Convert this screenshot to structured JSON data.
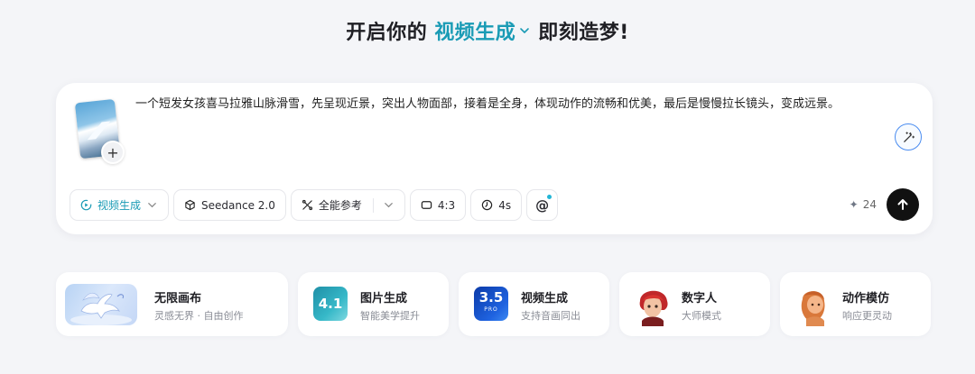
{
  "heading": {
    "prefix": "开启你的",
    "mode": "视频生成",
    "suffix": "即刻造梦!"
  },
  "composer": {
    "prompt": "一个短发女孩喜马拉雅山脉滑雪，先呈现近景，突出人物面部，接着是全身，体现动作的流畅和优美，最后是慢慢拉长镜头，变成远景。",
    "add_label": "+",
    "toolbar": {
      "mode": "视频生成",
      "model": "Seedance 2.0",
      "reference": "全能参考",
      "ratio": "4:3",
      "duration": "4s",
      "mention": "@"
    },
    "credits": "24",
    "colors": {
      "accent": "#1a9bb5",
      "send": "#111111"
    }
  },
  "cards": [
    {
      "title": "无限画布",
      "subtitle": "灵感无界 · 自由创作",
      "icon": "pegasus-canvas-icon"
    },
    {
      "title": "图片生成",
      "subtitle": "智能美学提升",
      "icon_text": "4.1",
      "icon": "image-model-icon"
    },
    {
      "title": "视频生成",
      "subtitle": "支持音画同出",
      "icon_text": "3.5",
      "icon_sub": "PRO",
      "icon": "video-model-icon"
    },
    {
      "title": "数字人",
      "subtitle": "大师模式",
      "icon": "digital-human-icon"
    },
    {
      "title": "动作模仿",
      "subtitle": "响应更灵动",
      "icon": "motion-mimic-icon"
    }
  ]
}
